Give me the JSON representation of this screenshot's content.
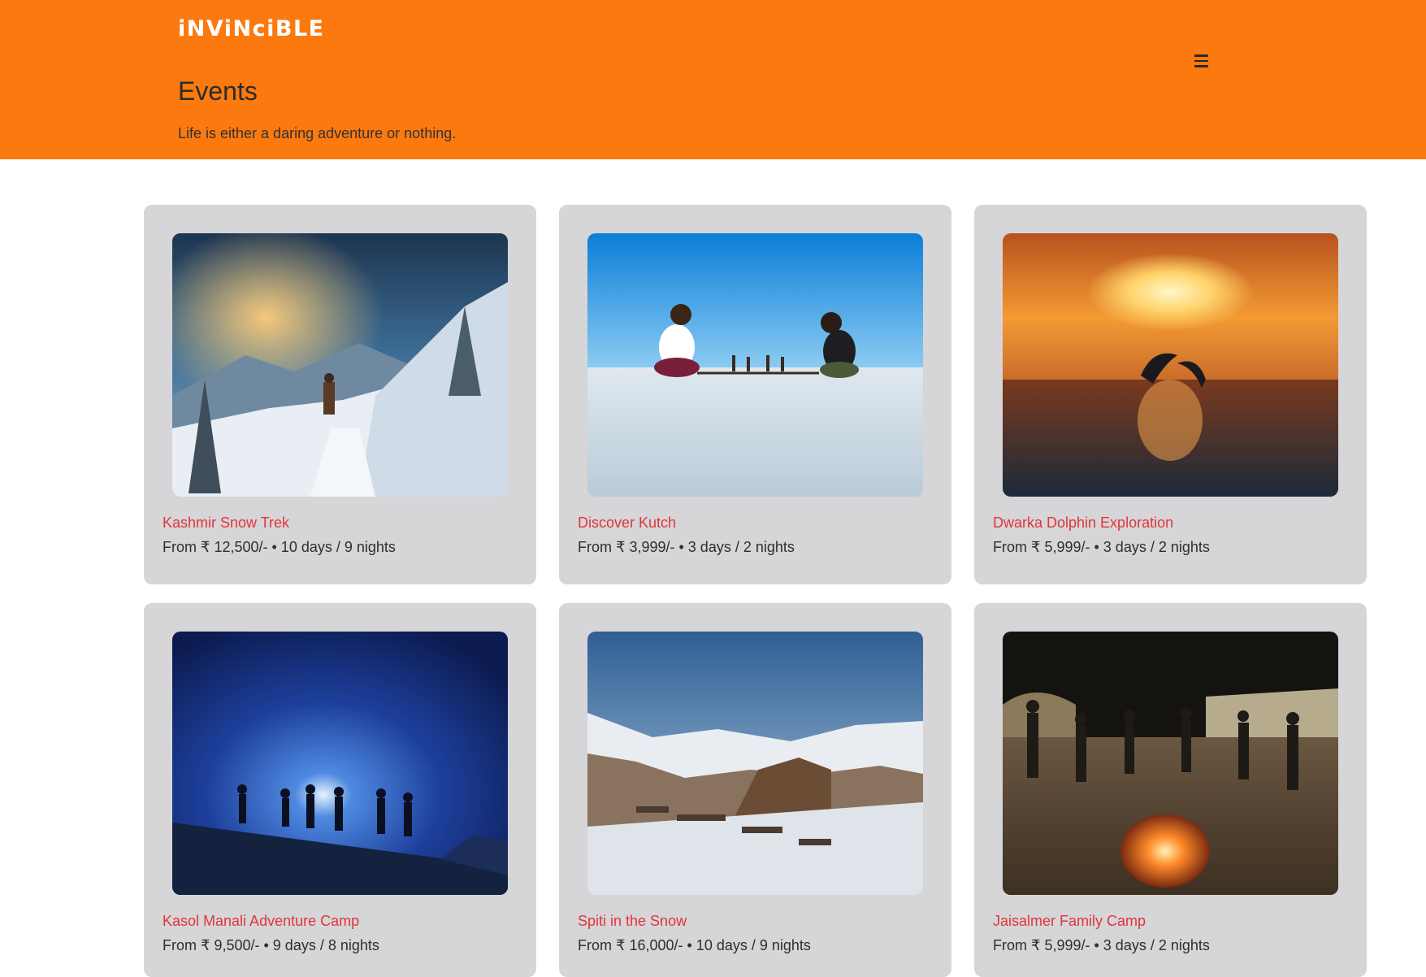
{
  "header": {
    "logo_text": "iNViNciBLE",
    "menu_icon": "hamburger-menu-icon",
    "title": "Events",
    "tagline": "Life is either a daring adventure or nothing.",
    "background_color": "#fb790f"
  },
  "accent_color": "#e0363a",
  "events": [
    {
      "title": "Kashmir Snow Trek",
      "meta": "From ₹ 12,500/- • 10 days / 9 nights"
    },
    {
      "title": "Discover Kutch",
      "meta": "From ₹ 3,999/- • 3 days / 2 nights"
    },
    {
      "title": "Dwarka Dolphin Exploration",
      "meta": "From ₹ 5,999/- • 3 days / 2 nights"
    },
    {
      "title": "Kasol Manali Adventure Camp",
      "meta": "From ₹ 9,500/- • 9 days / 8 nights"
    },
    {
      "title": "Spiti in the Snow",
      "meta": "From ₹ 16,000/- • 10 days / 9 nights"
    },
    {
      "title": "Jaisalmer Family Camp",
      "meta": "From ₹ 5,999/- • 3 days / 2 nights"
    }
  ]
}
